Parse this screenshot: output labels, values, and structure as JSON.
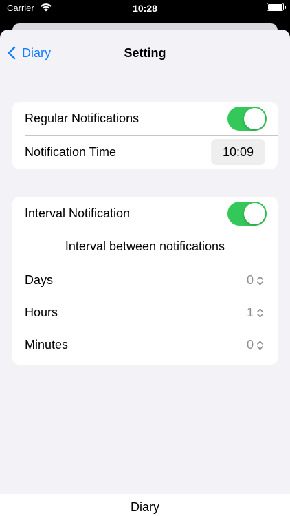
{
  "status_bar": {
    "carrier": "Carrier",
    "time": "10:28"
  },
  "nav": {
    "back_label": "Diary",
    "title": "Setting"
  },
  "regular_notifications": {
    "label": "Regular Notifications",
    "enabled": true
  },
  "notification_time": {
    "label": "Notification Time",
    "value": "10:09"
  },
  "interval_notification": {
    "label": "Interval Notification",
    "enabled": true,
    "caption": "Interval between notifications",
    "fields": [
      {
        "label": "Days",
        "value": "0"
      },
      {
        "label": "Hours",
        "value": "1"
      },
      {
        "label": "Minutes",
        "value": "0"
      }
    ]
  },
  "tab_bar": {
    "label": "Diary"
  },
  "colors": {
    "accent": "#147efb",
    "toggle_on": "#34c759",
    "secondary_text": "#8e8e93",
    "background": "#f2f2f7"
  }
}
